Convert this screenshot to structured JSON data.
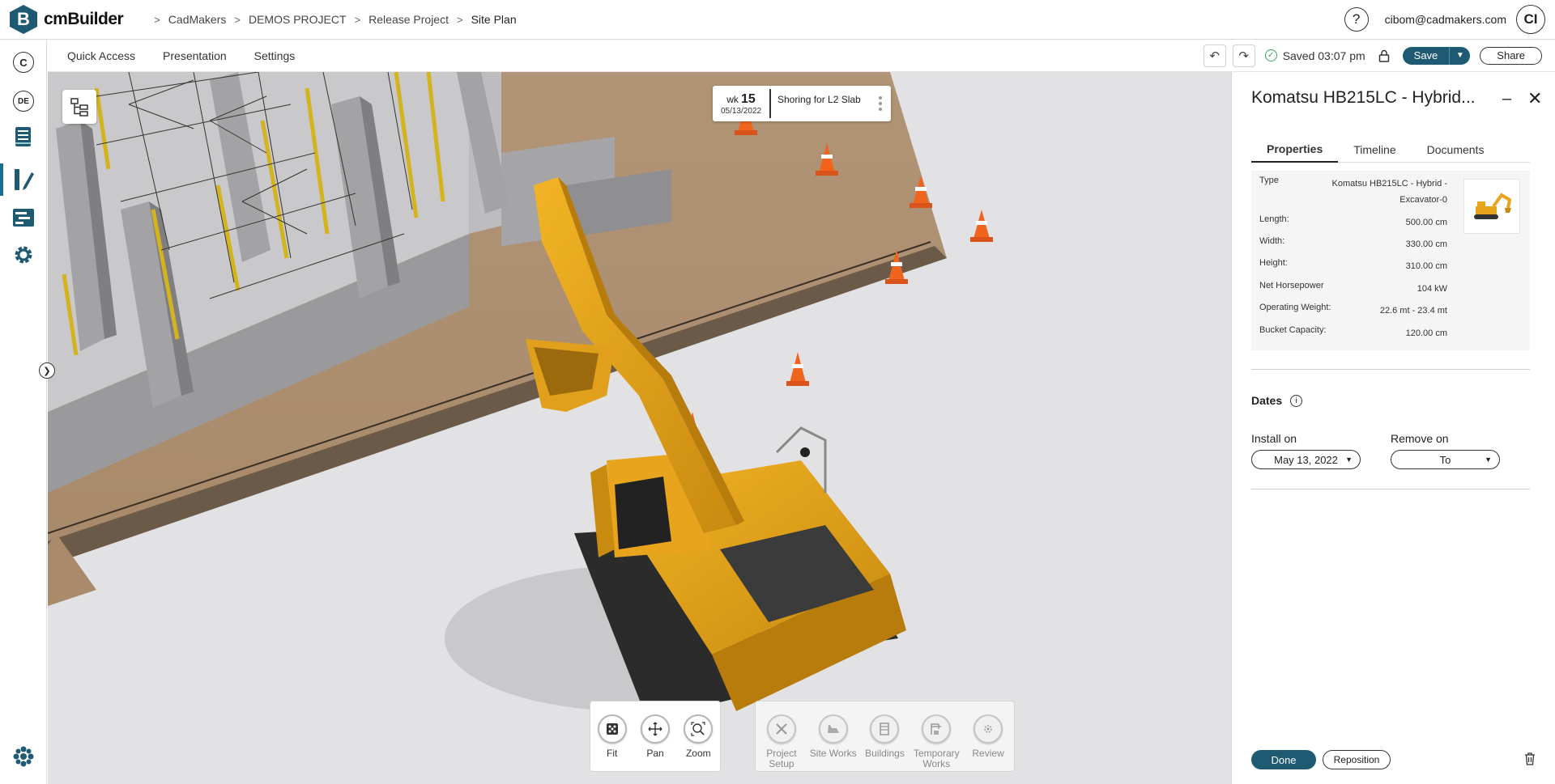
{
  "app": {
    "logo_letter": "B",
    "name": "cmBuilder"
  },
  "breadcrumb": [
    "CadMakers",
    "DEMOS PROJECT",
    "Release Project",
    "Site Plan"
  ],
  "header": {
    "help_label": "?",
    "user_email": "cibom@cadmakers.com",
    "avatar_initials": "CI"
  },
  "rail": {
    "company_initial": "C",
    "language": "DE"
  },
  "menu": {
    "items": [
      "Quick Access",
      "Presentation",
      "Settings"
    ]
  },
  "toolbar": {
    "saved_label": "Saved 03:07 pm",
    "save_label": "Save",
    "share_label": "Share"
  },
  "timeline_card": {
    "wk_label": "wk",
    "wk_number": "15",
    "date": "05/13/2022",
    "task": "Shoring for L2 Slab"
  },
  "nav_tools": [
    {
      "label": "Fit",
      "icon": "fit-icon"
    },
    {
      "label": "Pan",
      "icon": "pan-icon"
    },
    {
      "label": "Zoom",
      "icon": "zoom-icon"
    }
  ],
  "phase_tools": [
    {
      "label": "Project Setup",
      "icon": "project-setup-icon"
    },
    {
      "label": "Site Works",
      "icon": "site-works-icon"
    },
    {
      "label": "Buildings",
      "icon": "buildings-icon"
    },
    {
      "label": "Temporary Works",
      "icon": "temporary-works-icon"
    },
    {
      "label": "Review",
      "icon": "review-icon"
    }
  ],
  "panel": {
    "title": "Komatsu HB215LC - Hybrid...",
    "tabs": [
      "Properties",
      "Timeline",
      "Documents"
    ],
    "active_tab": "Properties",
    "properties": [
      {
        "label": "Type",
        "value": "Komatsu HB215LC - Hybrid - Excavator-0"
      },
      {
        "label": "Length:",
        "value": "500.00 cm"
      },
      {
        "label": "Width:",
        "value": "330.00 cm"
      },
      {
        "label": "Height:",
        "value": "310.00 cm"
      },
      {
        "label": "Net Horsepower",
        "value": "104 kW"
      },
      {
        "label": "Operating Weight:",
        "value": "22.6 mt - 23.4 mt"
      },
      {
        "label": "Bucket Capacity:",
        "value": "120.00 cm"
      }
    ],
    "dates_heading": "Dates",
    "install_label": "Install on",
    "install_value": "May 13, 2022",
    "remove_label": "Remove on",
    "remove_value": "To",
    "done_label": "Done",
    "reposition_label": "Reposition"
  },
  "colors": {
    "brand": "#1f5a73",
    "excavator": "#e8a41c",
    "cone": "#f0641e",
    "ground": "#ad8c6c",
    "saved": "#37a55a"
  }
}
